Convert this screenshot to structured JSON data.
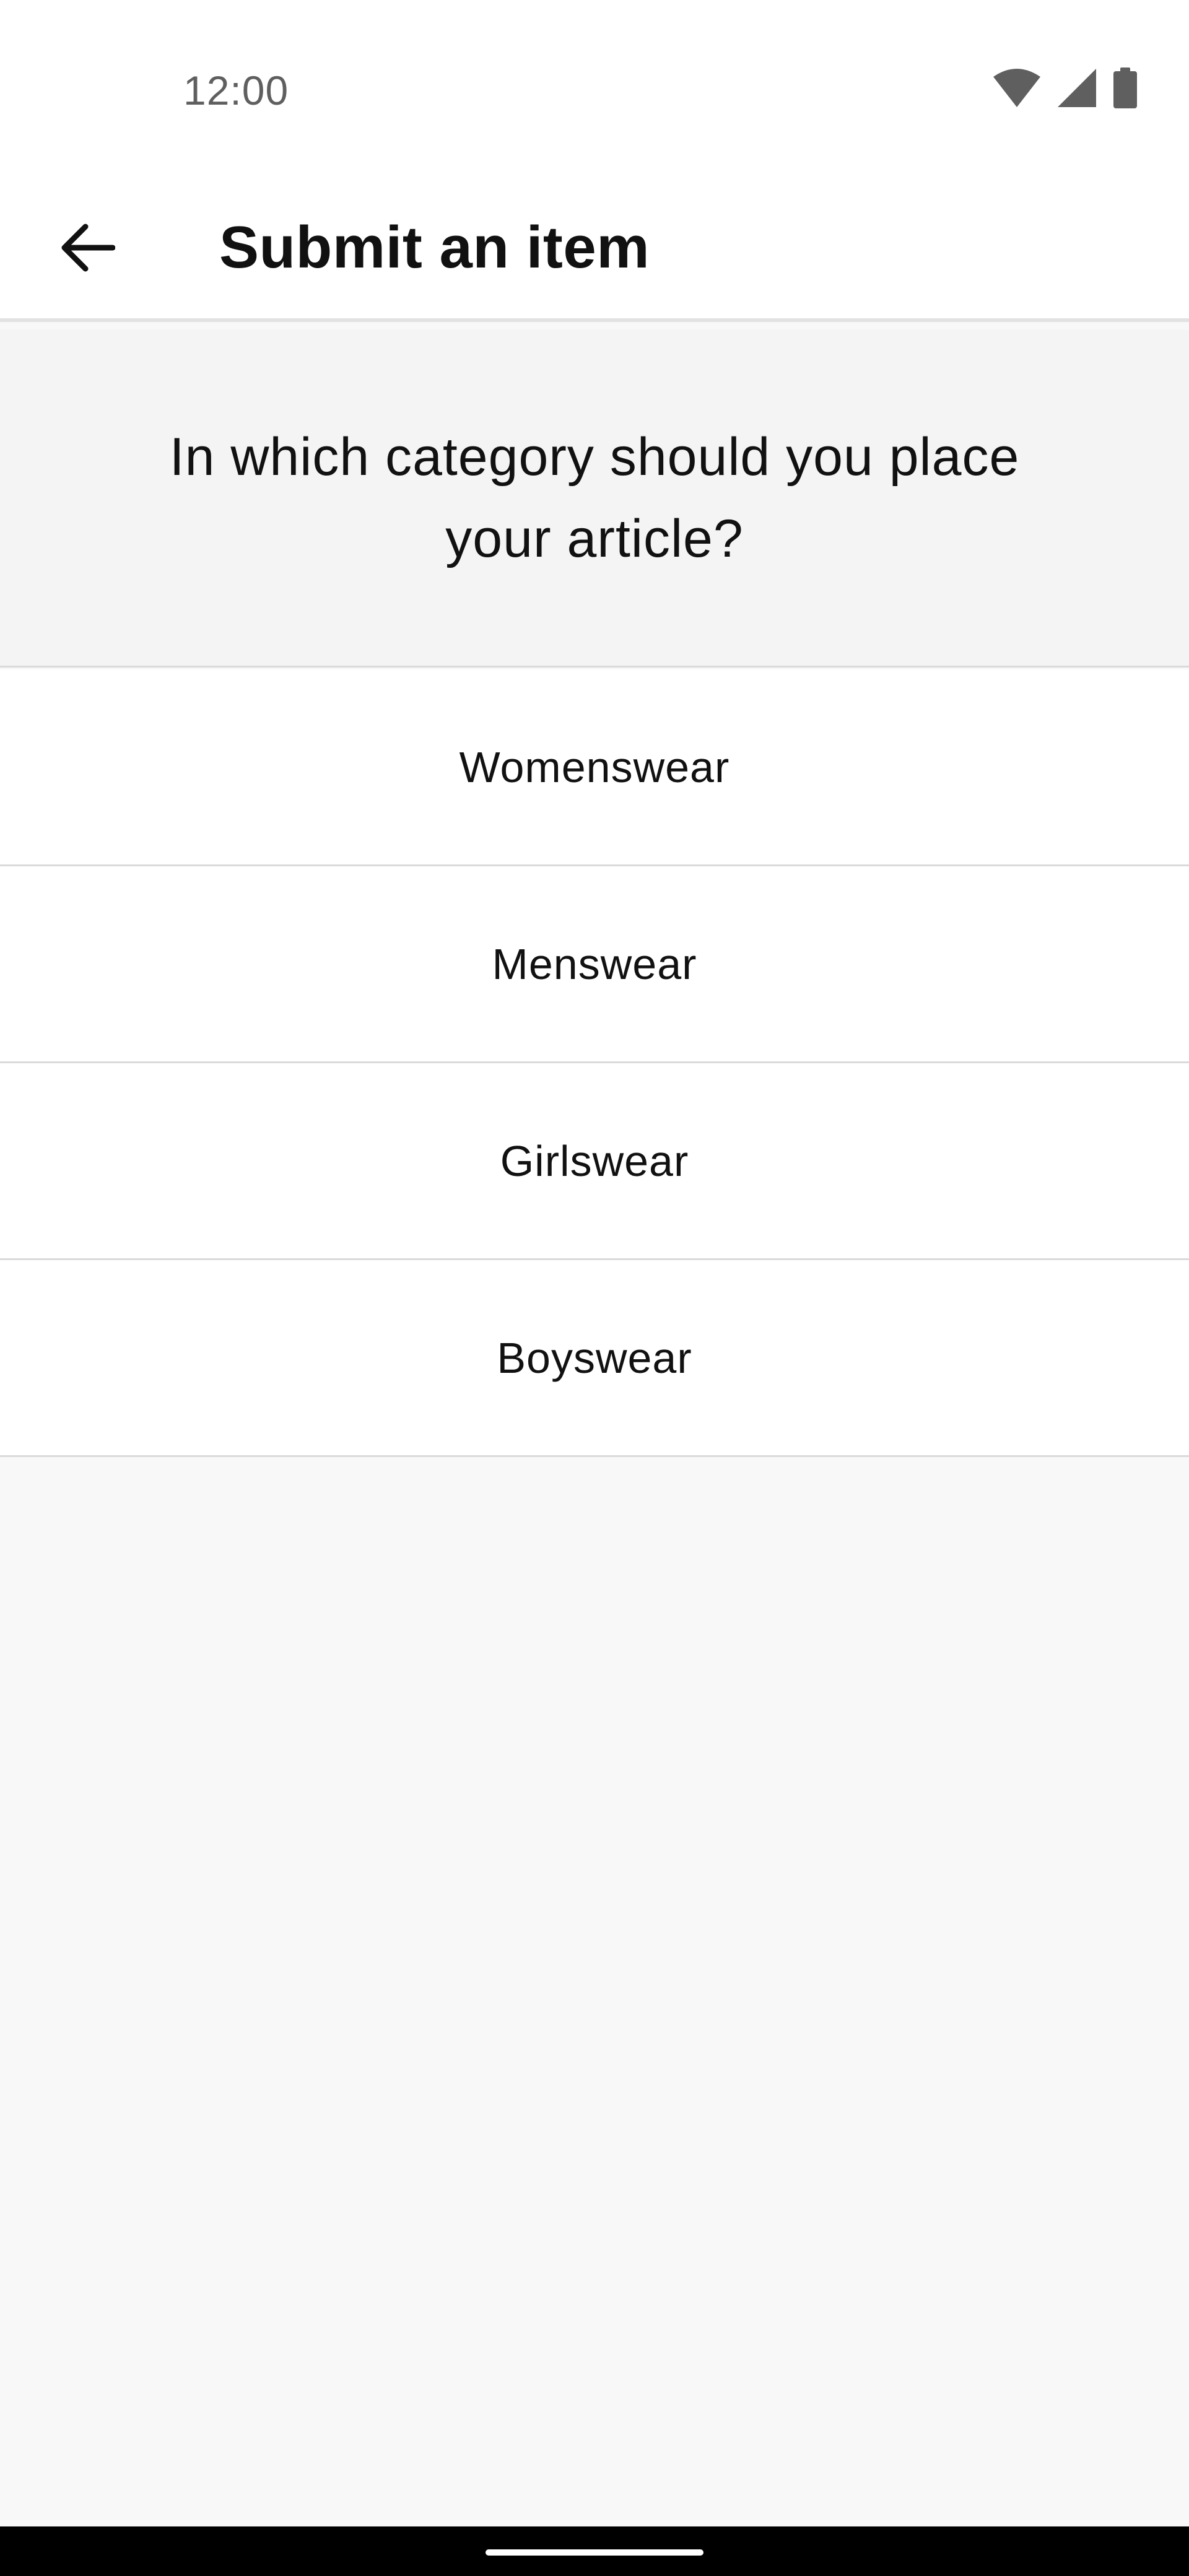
{
  "status_bar": {
    "time": "12:00",
    "icons": [
      "wifi-icon",
      "cell-signal-icon",
      "battery-icon"
    ]
  },
  "app_bar": {
    "back_icon": "arrow-left-icon",
    "title": "Submit an item"
  },
  "question": {
    "text": "In which category should you place your article?"
  },
  "categories": [
    {
      "label": "Womenswear"
    },
    {
      "label": "Menswear"
    },
    {
      "label": "Girlswear"
    },
    {
      "label": "Boyswear"
    }
  ],
  "colors": {
    "background": "#f8f8f8",
    "surface": "#ffffff",
    "text": "#111111",
    "divider": "#dadada",
    "status_text": "#5f5f5f"
  }
}
